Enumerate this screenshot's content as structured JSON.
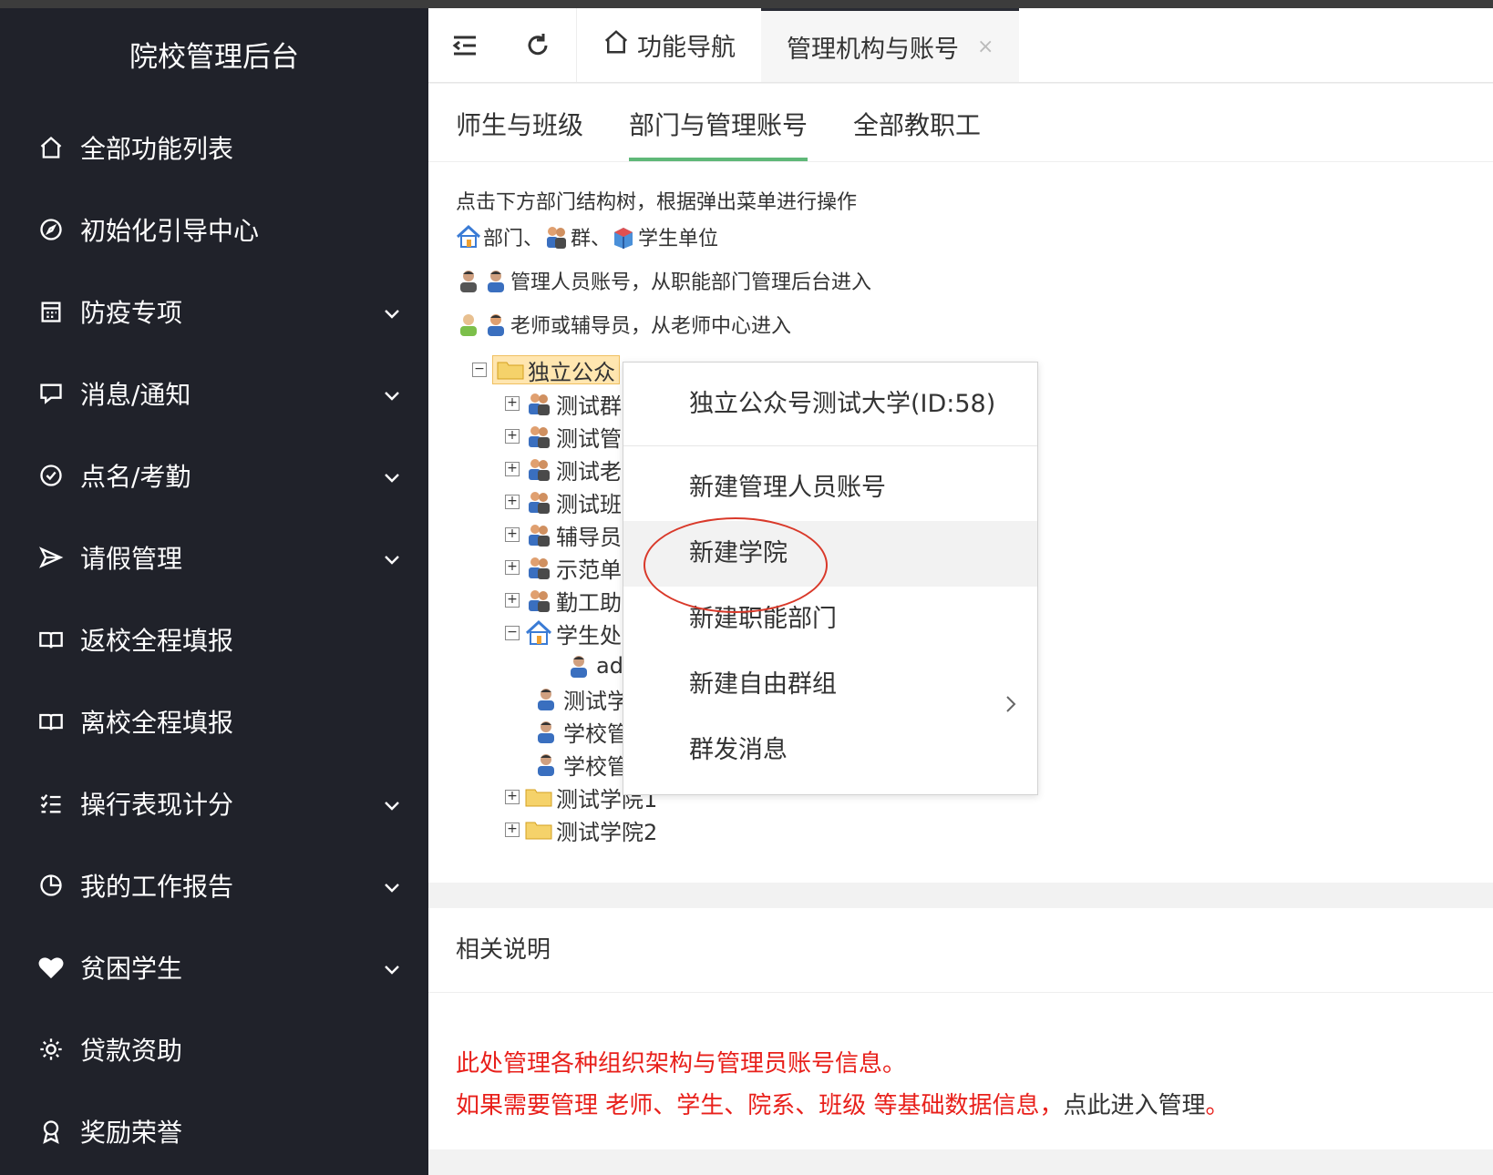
{
  "app": {
    "title": "院校管理后台"
  },
  "sidebar": {
    "items": [
      {
        "label": "全部功能列表",
        "icon": "home-icon",
        "expandable": false
      },
      {
        "label": "初始化引导中心",
        "icon": "compass-icon",
        "expandable": false
      },
      {
        "label": "防疫专项",
        "icon": "calendar-icon",
        "expandable": true
      },
      {
        "label": "消息/通知",
        "icon": "chat-icon",
        "expandable": true
      },
      {
        "label": "点名/考勤",
        "icon": "check-circle-icon",
        "expandable": true
      },
      {
        "label": "请假管理",
        "icon": "send-icon",
        "expandable": true
      },
      {
        "label": "返校全程填报",
        "icon": "book-icon",
        "expandable": false
      },
      {
        "label": "离校全程填报",
        "icon": "book-icon",
        "expandable": false
      },
      {
        "label": "操行表现计分",
        "icon": "list-check-icon",
        "expandable": true
      },
      {
        "label": "我的工作报告",
        "icon": "clock-icon",
        "expandable": true
      },
      {
        "label": "贫困学生",
        "icon": "heart-icon",
        "expandable": true
      },
      {
        "label": "贷款资助",
        "icon": "sun-icon",
        "expandable": false
      },
      {
        "label": "奖励荣誉",
        "icon": "award-icon",
        "expandable": false
      }
    ]
  },
  "topbar": {
    "tabs": [
      {
        "label": "功能导航",
        "icon": "home-icon"
      },
      {
        "label": "管理机构与账号",
        "close": "×"
      }
    ]
  },
  "subtabs": [
    "师生与班级",
    "部门与管理账号",
    "全部教职工"
  ],
  "tips": {
    "line1": "点击下方部门结构树，根据弹出菜单进行操作",
    "line2_a": "部门、",
    "line2_b": "群、",
    "line2_c": "学生单位",
    "line3": "管理人员账号，从职能部门管理后台进入",
    "line4": "老师或辅导员，从老师中心进入"
  },
  "tree": {
    "root": "独立公众",
    "children": [
      "测试群",
      "测试管",
      "测试老",
      "测试班",
      "辅导员",
      "示范单",
      "勤工助",
      "学生处",
      "ad",
      "测试学",
      "学校管",
      "学校管",
      "测试学院1",
      "测试学院2"
    ]
  },
  "context_menu": {
    "title": "独立公众号测试大学(ID:58)",
    "items": [
      {
        "label": "新建管理人员账号"
      },
      {
        "label": "新建学院"
      },
      {
        "label": "新建职能部门"
      },
      {
        "label": "新建自由群组"
      },
      {
        "label": "群发消息"
      }
    ]
  },
  "related": {
    "title": "相关说明",
    "line1": "此处管理各种组织架构与管理员账号信息。",
    "line2_red": "如果需要管理 老师、学生、院系、班级 等基础数据信息，",
    "line2_link": "点此进入管理",
    "line2_end": "。"
  },
  "colors": {
    "sidebar_bg": "#20222a",
    "accent_green": "#5fb878",
    "warning_red": "#e8201b"
  }
}
